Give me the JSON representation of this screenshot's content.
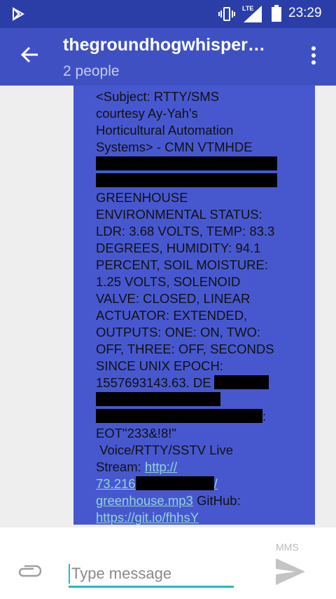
{
  "status_bar": {
    "clock": "23:29",
    "network_label": "LTE",
    "icons": [
      "play-store-icon",
      "vibrate-icon",
      "signal-lte-icon",
      "battery-icon"
    ]
  },
  "app_bar": {
    "title": "thegroundhogwhisper…",
    "subtitle": "2 people",
    "icons": [
      "back-arrow-icon",
      "overflow-menu-icon"
    ]
  },
  "message": {
    "lines": [
      "<Subject: RTTY/SMS",
      "courtesy Ay-Yah's",
      "Horticultural Automation",
      "Systems> - CMN VTMHDE",
      "GREENHOUSE",
      "ENVIRONMENTAL STATUS:",
      "LDR: 3.68 VOLTS, TEMP: 83.3",
      "DEGREES, HUMIDITY: 94.1",
      "PERCENT, SOIL MOISTURE:",
      "1.25 VOLTS, SOLENOID",
      "VALVE: CLOSED, LINEAR",
      "ACTUATOR: EXTENDED,",
      "OUTPUTS: ONE: ON, TWO:",
      "OFF, THREE: OFF, SECONDS",
      "SINCE UNIX EPOCH:",
      "1557693143.63. DE",
      ":",
      "EOT\"233&!8!\"",
      " Voice/RTTY/SSTV Live",
      "Stream: ",
      "http://",
      "73.216",
      "/",
      "greenhouse.mp3",
      " GitHub:",
      "https://git.io/fhhsY"
    ]
  },
  "composer": {
    "placeholder": "Type message",
    "mms_label": "MMS",
    "icons": [
      "attach-paperclip-icon",
      "send-icon"
    ]
  },
  "colors": {
    "status_bar": "#2b3ea8",
    "app_bar": "#3f51c2",
    "bubble": "#4758cf",
    "link": "#93d3d6",
    "input_underline": "#27b9c4"
  }
}
